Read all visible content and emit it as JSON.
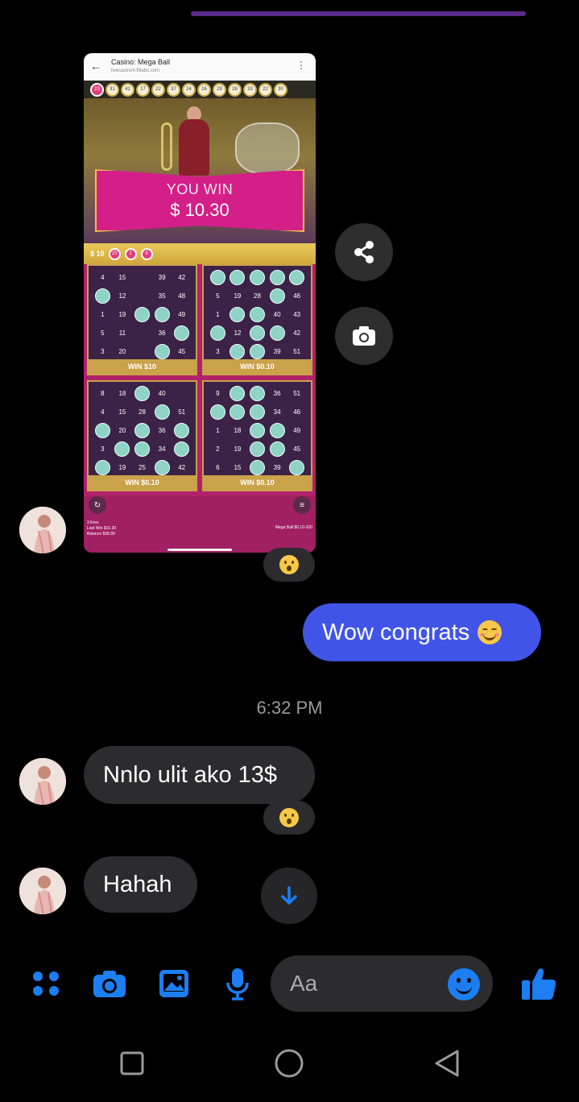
{
  "shared_screenshot": {
    "browser_title": "Casino: Mega Ball",
    "browser_url": "livecasino4.fitlabs.com",
    "drawn_balls": [
      "23",
      "31",
      "41",
      "17",
      "22",
      "37",
      "24",
      "16",
      "29",
      "28",
      "33",
      "22",
      "30"
    ],
    "win_banner": {
      "line1": "YOU WIN",
      "line2": "$ 10.30"
    },
    "gold_bar": {
      "amount": "$ 10",
      "balls": [
        "23",
        "2",
        "8"
      ]
    },
    "cards": [
      {
        "cells": [
          "4",
          "15",
          "",
          "39",
          "42",
          "",
          "12",
          "",
          "35",
          "48",
          "1",
          "19",
          "",
          "",
          "49",
          "5",
          "11",
          "",
          "36",
          "",
          "3",
          "20",
          "",
          "",
          "45"
        ],
        "hits": [
          5,
          12,
          13,
          19,
          23
        ],
        "win": "WIN $10"
      },
      {
        "cells": [
          "",
          "",
          "",
          "",
          "",
          "5",
          "19",
          "28",
          "",
          "46",
          "1",
          "",
          "",
          "40",
          "43",
          "",
          "12",
          "",
          "",
          "42",
          "3",
          "",
          "",
          "39",
          "51"
        ],
        "hits": [
          0,
          1,
          2,
          3,
          4,
          8,
          11,
          12,
          15,
          17,
          18,
          21,
          22
        ],
        "win": "WIN $0.10"
      },
      {
        "cells": [
          "8",
          "18",
          "",
          "40",
          "",
          "4",
          "15",
          "28",
          "",
          "51",
          "",
          "20",
          "",
          "36",
          "",
          "3",
          "",
          "",
          "34",
          "",
          "",
          "19",
          "25",
          "",
          "42"
        ],
        "hits": [
          2,
          8,
          10,
          12,
          14,
          16,
          17,
          19,
          20,
          23
        ],
        "win": "WIN $0.10"
      },
      {
        "cells": [
          "9",
          "",
          "",
          "36",
          "51",
          "",
          "",
          "",
          "34",
          "46",
          "1",
          "18",
          "",
          "",
          "49",
          "2",
          "19",
          "",
          "",
          "45",
          "6",
          "15",
          "",
          "39",
          ""
        ],
        "hits": [
          1,
          2,
          5,
          6,
          7,
          12,
          13,
          17,
          18,
          22,
          24
        ],
        "win": "WIN $0.10"
      }
    ],
    "footer": {
      "lines_label": "3 lines",
      "last_win": "Last Win $10.30",
      "balance": "Balance $38.89",
      "game": "Mega Ball $0.10-100"
    }
  },
  "messages": {
    "outgoing_1": "Wow congrats",
    "timestamp": "6:32 PM",
    "incoming_1": "Nnlo ulit ako 13$",
    "incoming_2": "Hahah"
  },
  "composer": {
    "placeholder": "Aa"
  },
  "colors": {
    "accent": "#1c7ef2",
    "outgoing_bubble": "#4154e8",
    "incoming_bubble": "#2c2c2e"
  },
  "icons": [
    "share-icon",
    "camera-icon",
    "menu-dots-icon",
    "image-icon",
    "mic-icon",
    "emoji-icon",
    "thumbs-up-icon",
    "arrow-down-icon"
  ]
}
